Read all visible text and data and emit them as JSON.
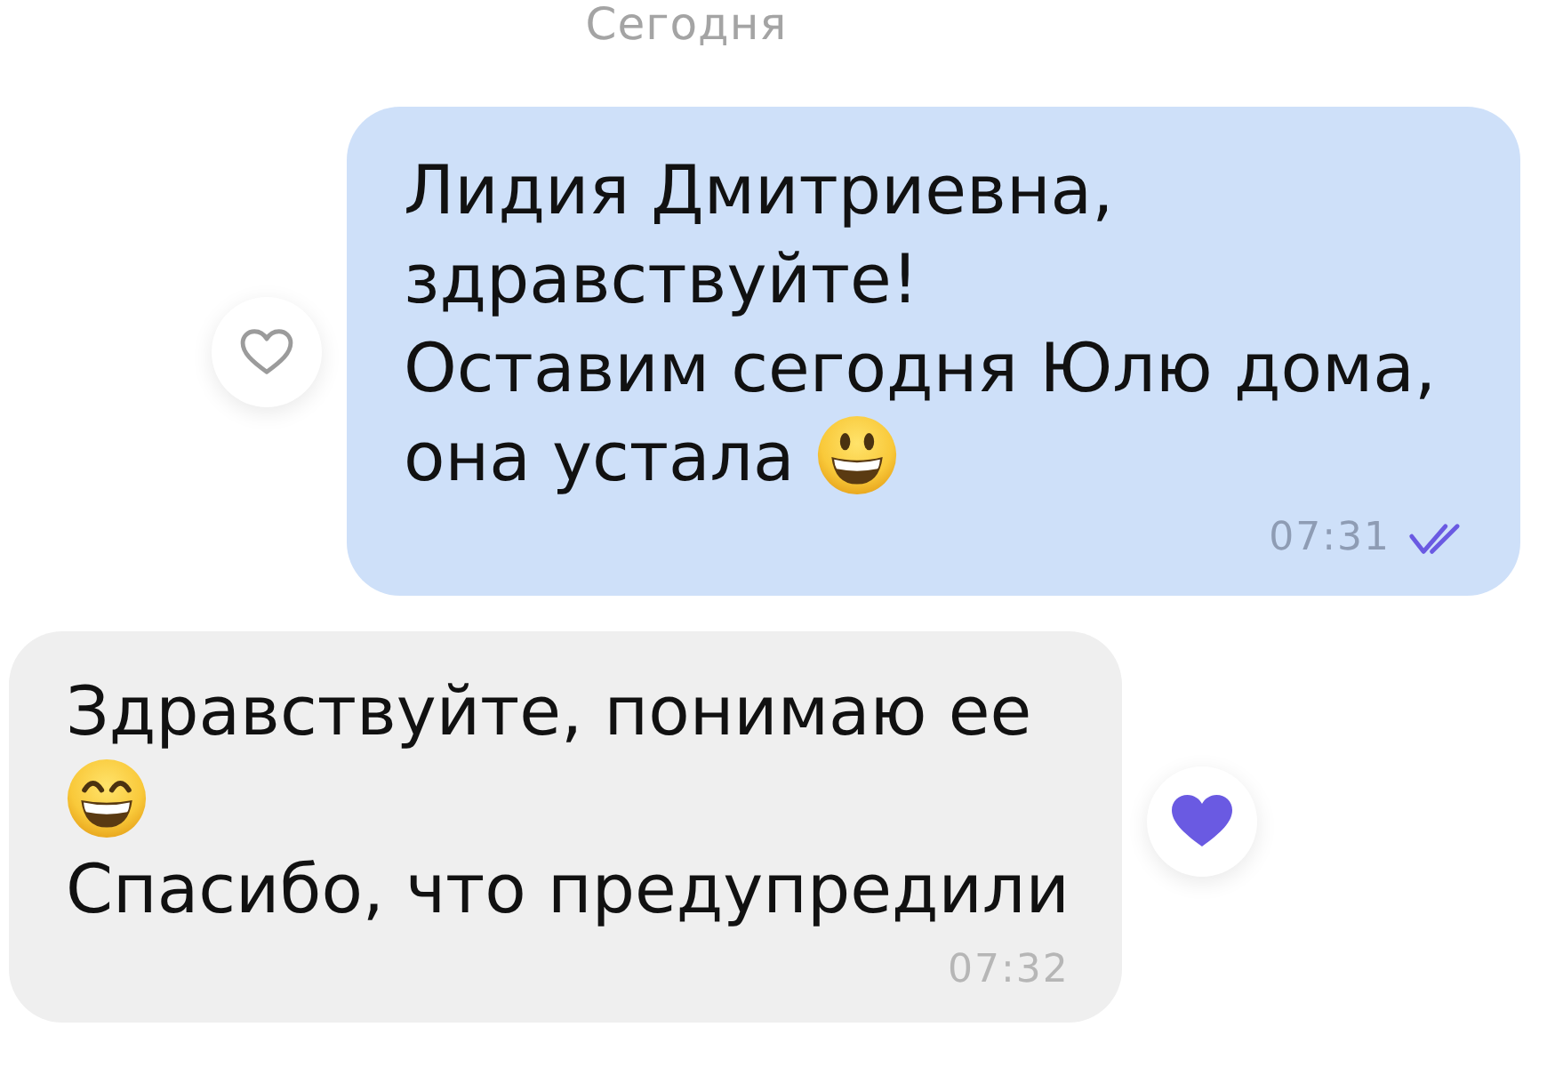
{
  "date_separator": {
    "label": "Сегодня"
  },
  "messages": [
    {
      "kind": "outgoing",
      "lines": [
        {
          "text": "Лидия Дмитриевна, здравствуйте!"
        },
        {
          "text": "Оставим сегодня Юлю дома,"
        },
        {
          "text": "она устала",
          "emoji": {
            "kind": "smiley"
          }
        }
      ],
      "time": "07:31",
      "read": true,
      "liked": false
    },
    {
      "kind": "incoming",
      "lines": [
        {
          "text": "Здравствуйте, понимаю ее"
        },
        {
          "emoji": {
            "kind": "grin"
          }
        },
        {
          "text": "Спасибо, что предупредили"
        }
      ],
      "time": "07:32",
      "liked": true
    }
  ]
}
